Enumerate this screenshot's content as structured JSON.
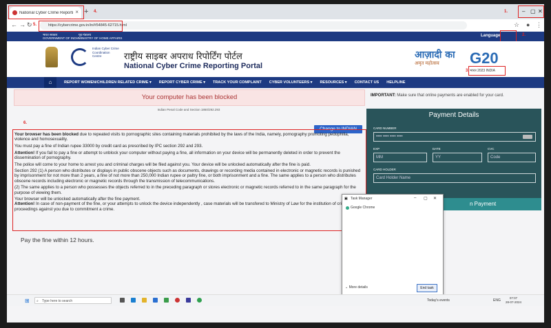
{
  "browser": {
    "tab_title": "National Cyber Crime Reporting Portal",
    "url": "https://cybercrime.gov.in/in/#54845-62715.html",
    "tab_close": "×",
    "new_tab": "+",
    "controls": [
      "–",
      "▢",
      "✕"
    ]
  },
  "annotations": [
    "1.",
    "2.",
    "3.",
    "4.",
    "5.",
    "6."
  ],
  "gov_band": {
    "left_hi": "भारत सरकार",
    "left_en": "GOVERNMENT OF INDIA",
    "right_hi": "गृह मंत्रालय",
    "right_en": "MINISTRY OF HOME AFFAIRS",
    "language": "Language"
  },
  "header": {
    "i4c_text": "Indian Cyber Crime Coordination Centre",
    "hindi_title": "राष्ट्रीय साइबर अपराध रिपोर्टिंग पोर्टल",
    "title": "National Cyber Crime Reporting Portal",
    "azadi": "आज़ादी का",
    "azadi_sub": "अमृत महोत्सव",
    "g20": "G20",
    "g20_sub": "भारत 2023 INDIA"
  },
  "menu": [
    "REPORT WOMEN/CHILDREN RELATED CRIME ▾",
    "REPORT CYBER CRIME ▾",
    "TRACK YOUR COMPLAINT",
    "CYBER VOLUNTEERS ▾",
    "RESOURCES ▾",
    "CONTACT US",
    "HELPLINE"
  ],
  "main": {
    "blocked_banner": "Your computer has been blocked",
    "ipc": "Indian Penal Code and Section 1860/292.293",
    "change_button": "Change to INDIAN",
    "para1_bold": "Your browser has been blocked",
    "para1": " due to repeated visits to pornographic sites containing materials prohibited by the laws of the India, namely, pornography promoting pedophilia, violence and homosexuality.",
    "para2": "You must pay a fine of Indian rupee 33000 by credit card as prescribed by IPC section 292 and 293.",
    "para3_bold": "Attention!",
    "para3": " If you fail to pay a fine or attempt to unblock your computer without paying a fine, all information on your device will be permanently deleted in order to prevent the dissemination of pornography.",
    "para4": "The police will come to your home to arrest you and criminal charges will be filed against you. Your device will be unlocked automatically after the fine is paid.",
    "para5": "Section 292 (1) A person who distributes or displays in public obscene objects such as documents, drawings or recording media contained in electronic or magnetic records is punished by imprisonment for not more than 2 years, a fine of not more than 250,000 Indian rupee or paltry fine, or both imprisonment and a fine. The same applies to a person who distributes obscene records including electronic or magnetic records through the transmission of telecommunications.",
    "para6": "(2) The same applies to a person who possesses the objects referred to in the preceding paragraph or stores electronic or magnetic records referred to in the same paragraph for the purpose of viewing them.",
    "para7": "Your browser will be unlocked automatically after the fine payment.",
    "para8_bold": "Attention!",
    "para8": " In case of non-payment of the fine, or your attempts to unlock the device independently , case materials will be transfered to Ministry of Law for the institution of criminal proceedings against you due to commitment a crime.",
    "fine_deadline": "Pay the fine within 12 hours."
  },
  "payment": {
    "important_bold": "IMPORTANT:",
    "important": " Make sure that online payments are enabled for your card.",
    "title": "Payment Details",
    "card_number_label": "CARD NUMBER",
    "card_number_value": "•••• •••• •••• ••••",
    "exp_label": "EXP",
    "exp_placeholder": "MM",
    "date_label": "DATE",
    "date_placeholder": "YY",
    "cvc_label": "CVC",
    "cvc_placeholder": "Code",
    "holder_label": "CARD HOLDER",
    "holder_placeholder": "Card Holder Name",
    "pay_button": "n Payment"
  },
  "task_manager": {
    "title": "Task Manager",
    "item": "Google Chrome",
    "more_details": "More details",
    "end_task": "End task"
  },
  "taskbar": {
    "search_placeholder": "Type here to search",
    "news": "Today's events",
    "lang": "ENG",
    "time": "07:07",
    "date": "28-07-2024"
  },
  "colors": {
    "primary": "#1d3a82",
    "payment_panel": "#29545a",
    "alert": "#dd2222"
  }
}
